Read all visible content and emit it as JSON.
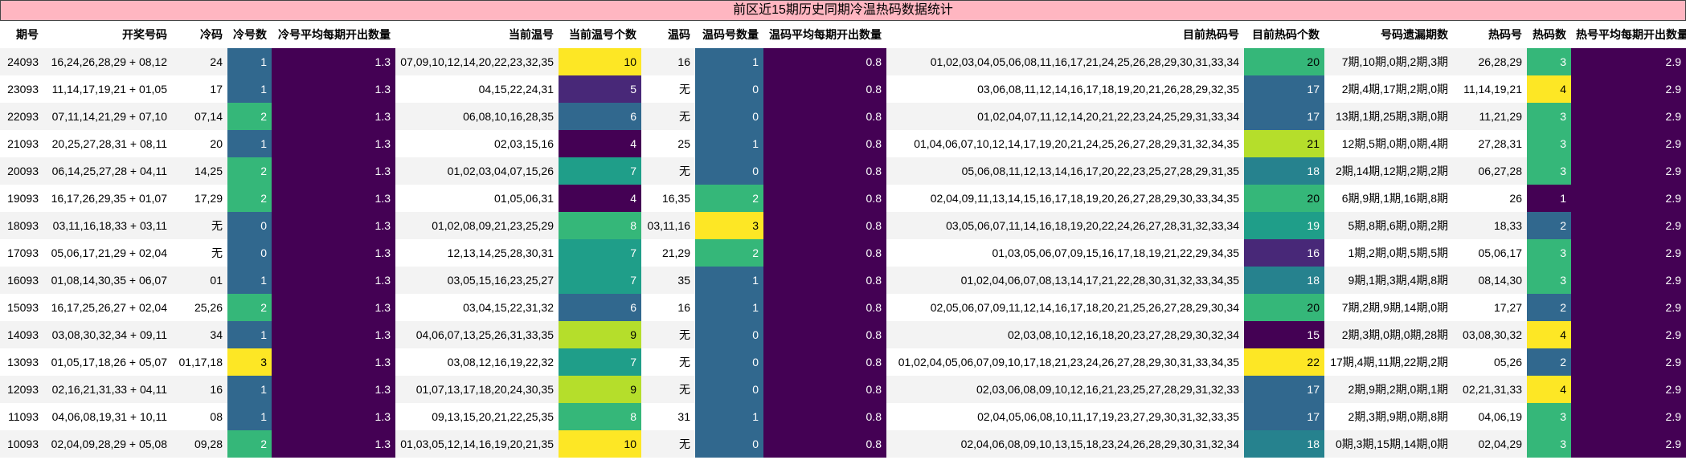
{
  "title": "前区近15期历史同期冷温热码数据统计",
  "columns": [
    "期号",
    "开奖号码",
    "冷码",
    "冷号数",
    "冷号平均每期开出数量",
    "当前温号",
    "当前温号个数",
    "温码",
    "温码号数量",
    "温码平均每期开出数量",
    "目前热码号",
    "目前热码个数",
    "号码遗漏期数",
    "热码号",
    "热码数",
    "热号平均每期开出数量"
  ],
  "colors": {
    "purple": "#440154",
    "indigo": "#482878",
    "blue_dark": "#3e4989",
    "blue": "#31688e",
    "teal_blue": "#26828e",
    "teal": "#1f9e89",
    "green": "#35b779",
    "lime": "#6ece58",
    "yellow_green": "#b5de2b",
    "yellow": "#fde725"
  },
  "rows": [
    [
      "24093",
      "16,24,26,28,29 + 08,12",
      "24",
      "1",
      "1.3",
      "07,09,10,12,14,20,22,23,32,35",
      "10",
      "16",
      "1",
      "0.8",
      "01,02,03,04,05,06,08,11,16,17,21,24,25,26,28,29,30,31,33,34",
      "20",
      "7期,10期,0期,2期,3期",
      "26,28,29",
      "3",
      "2.9"
    ],
    [
      "23093",
      "11,14,17,19,21 + 01,05",
      "17",
      "1",
      "1.3",
      "04,15,22,24,31",
      "5",
      "无",
      "0",
      "0.8",
      "03,06,08,11,12,14,16,17,18,19,20,21,26,28,29,32,35",
      "17",
      "2期,4期,17期,2期,0期",
      "11,14,19,21",
      "4",
      "2.9"
    ],
    [
      "22093",
      "07,11,14,21,29 + 07,10",
      "07,14",
      "2",
      "1.3",
      "06,08,10,16,28,35",
      "6",
      "无",
      "0",
      "0.8",
      "01,02,04,07,11,12,14,20,21,22,23,24,25,29,31,33,34",
      "17",
      "13期,1期,25期,3期,0期",
      "11,21,29",
      "3",
      "2.9"
    ],
    [
      "21093",
      "20,25,27,28,31 + 08,11",
      "20",
      "1",
      "1.3",
      "02,03,15,16",
      "4",
      "25",
      "1",
      "0.8",
      "01,04,06,07,10,12,14,17,19,20,21,24,25,26,27,28,29,31,32,34,35",
      "21",
      "12期,5期,0期,0期,4期",
      "27,28,31",
      "3",
      "2.9"
    ],
    [
      "20093",
      "06,14,25,27,28 + 04,11",
      "14,25",
      "2",
      "1.3",
      "01,02,03,04,07,15,26",
      "7",
      "无",
      "0",
      "0.8",
      "05,06,08,11,12,13,14,16,17,20,22,23,25,27,28,29,31,35",
      "18",
      "2期,14期,12期,2期,2期",
      "06,27,28",
      "3",
      "2.9"
    ],
    [
      "19093",
      "16,17,26,29,35 + 01,07",
      "17,29",
      "2",
      "1.3",
      "01,05,06,31",
      "4",
      "16,35",
      "2",
      "0.8",
      "02,04,09,11,13,14,15,16,17,18,19,20,26,27,28,29,30,33,34,35",
      "20",
      "6期,9期,1期,16期,8期",
      "26",
      "1",
      "2.9"
    ],
    [
      "18093",
      "03,11,16,18,33 + 03,11",
      "无",
      "0",
      "1.3",
      "01,02,08,09,21,23,25,29",
      "8",
      "03,11,16",
      "3",
      "0.8",
      "03,05,06,07,11,14,16,18,19,20,22,24,26,27,28,31,32,33,34",
      "19",
      "5期,8期,6期,0期,2期",
      "18,33",
      "2",
      "2.9"
    ],
    [
      "17093",
      "05,06,17,21,29 + 02,04",
      "无",
      "0",
      "1.3",
      "12,13,14,25,28,30,31",
      "7",
      "21,29",
      "2",
      "0.8",
      "01,03,05,06,07,09,15,16,17,18,19,21,22,29,34,35",
      "16",
      "1期,2期,0期,5期,5期",
      "05,06,17",
      "3",
      "2.9"
    ],
    [
      "16093",
      "01,08,14,30,35 + 06,07",
      "01",
      "1",
      "1.3",
      "03,05,15,16,23,25,27",
      "7",
      "35",
      "1",
      "0.8",
      "01,02,04,06,07,08,13,14,17,21,22,28,30,31,32,33,34,35",
      "18",
      "9期,1期,3期,4期,8期",
      "08,14,30",
      "3",
      "2.9"
    ],
    [
      "15093",
      "16,17,25,26,27 + 02,04",
      "25,26",
      "2",
      "1.3",
      "03,04,15,22,31,32",
      "6",
      "16",
      "1",
      "0.8",
      "02,05,06,07,09,11,12,14,16,17,18,20,21,25,26,27,28,29,30,34",
      "20",
      "7期,2期,9期,14期,0期",
      "17,27",
      "2",
      "2.9"
    ],
    [
      "14093",
      "03,08,30,32,34 + 09,11",
      "34",
      "1",
      "1.3",
      "04,06,07,13,25,26,31,33,35",
      "9",
      "无",
      "0",
      "0.8",
      "02,03,08,10,12,16,18,20,23,27,28,29,30,32,34",
      "15",
      "2期,3期,0期,0期,28期",
      "03,08,30,32",
      "4",
      "2.9"
    ],
    [
      "13093",
      "01,05,17,18,26 + 05,07",
      "01,17,18",
      "3",
      "1.3",
      "03,08,12,16,19,22,32",
      "7",
      "无",
      "0",
      "0.8",
      "01,02,04,05,06,07,09,10,17,18,21,23,24,26,27,28,29,30,31,33,34,35",
      "22",
      "17期,4期,11期,22期,2期",
      "05,26",
      "2",
      "2.9"
    ],
    [
      "12093",
      "02,16,21,31,33 + 04,11",
      "16",
      "1",
      "1.3",
      "01,07,13,17,18,20,24,30,35",
      "9",
      "无",
      "0",
      "0.8",
      "02,03,06,08,09,10,12,16,21,23,25,27,28,29,31,32,33",
      "17",
      "2期,9期,2期,0期,1期",
      "02,21,31,33",
      "4",
      "2.9"
    ],
    [
      "11093",
      "04,06,08,19,31 + 10,11",
      "08",
      "1",
      "1.3",
      "09,13,15,20,21,22,25,35",
      "8",
      "31",
      "1",
      "0.8",
      "02,04,05,06,08,10,11,17,19,23,27,29,30,31,32,33,35",
      "17",
      "2期,3期,9期,0期,8期",
      "04,06,19",
      "3",
      "2.9"
    ],
    [
      "10093",
      "02,04,09,28,29 + 05,08",
      "09,28",
      "2",
      "1.3",
      "01,03,05,12,14,16,19,20,21,35",
      "10",
      "无",
      "0",
      "0.8",
      "02,04,06,08,09,10,13,15,18,23,24,26,28,29,30,31,32,34",
      "18",
      "0期,3期,15期,14期,0期",
      "02,04,29",
      "3",
      "2.9"
    ]
  ]
}
